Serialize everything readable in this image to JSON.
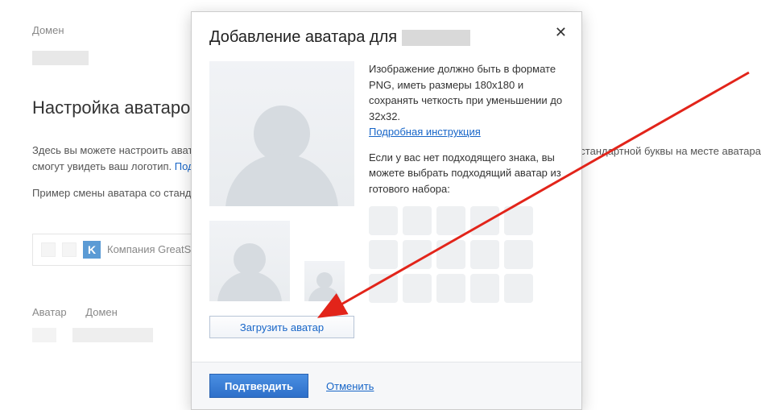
{
  "bg": {
    "domain_label": "Домен",
    "heading": "Настройка аватаров ваш",
    "description_line1": "Здесь вы можете настроить аватар",
    "description_line2": "смогут увидеть ваш логотип.",
    "description_line2_link": "Подро",
    "description_line3_prefix": "Пример смены аватара со стандарт",
    "right_cutoff_text": "о стандартной буквы на месте аватара",
    "company_name": "Компания GreatSta",
    "k_letter": "K",
    "table": {
      "avatar": "Аватар",
      "domain": "Домен"
    }
  },
  "modal": {
    "title_prefix": "Добавление аватара для",
    "instructions": "Изображение должно быть в формате PNG, иметь размеры 180x180 и сохранять четкость при уменьшении до 32x32.",
    "instructions_link": "Подробная инструкция",
    "no_image_text": "Если у вас нет подходящего знака, вы можете выбрать подходящий аватар из готового набора:",
    "upload_button": "Загрузить аватар",
    "confirm_button": "Подтвердить",
    "cancel_link": "Отменить"
  }
}
